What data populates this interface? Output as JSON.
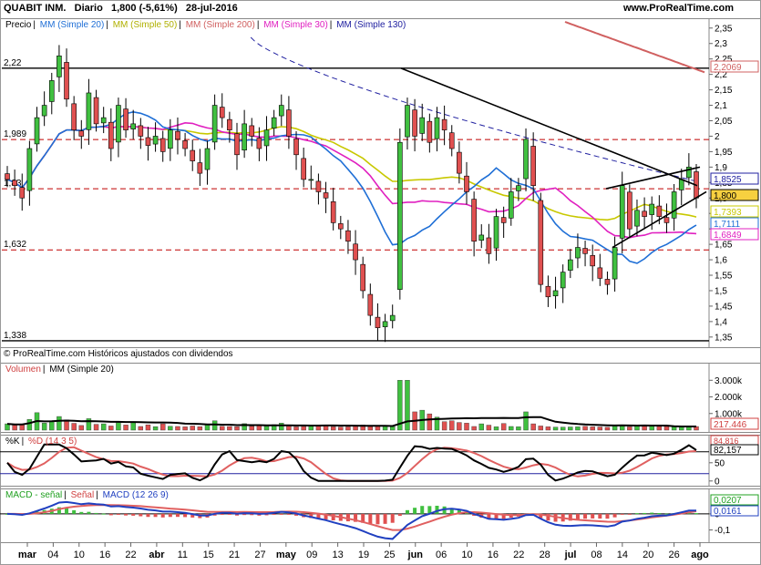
{
  "header": {
    "instrument": "QUABIT INM.",
    "period": "Diario",
    "quote": "1,800 (-5,61%)",
    "date": "28-jul-2016",
    "site": "www.ProRealTime.com"
  },
  "price_panel": {
    "legend": [
      {
        "text": "Precio",
        "color": "#000000"
      },
      {
        "text": "MM (Simple 20)",
        "color": "#1f6fd6"
      },
      {
        "text": "MM (Simple 50)",
        "color": "#c8c800"
      },
      {
        "text": "MM (Simple 200)",
        "color": "#d06060"
      },
      {
        "text": "MM (Simple 30)",
        "color": "#e020c0"
      },
      {
        "text": "MM (Simple 130)",
        "color": "#2020a0"
      }
    ],
    "footer": "© ProRealTime.com Históricos ajustados con dividendos",
    "left_levels": [
      "2,22",
      "1,989",
      "1,83",
      "1,632",
      "1,338"
    ],
    "right_badges": [
      {
        "text": "2,2069",
        "color": "#d06060"
      },
      {
        "text": "1,8525",
        "color": "#2020a0"
      },
      {
        "text": "1,800",
        "color": "#000000"
      },
      {
        "text": "1,7393",
        "color": "#c8c800"
      },
      {
        "text": "1,7111",
        "color": "#1f6fd6"
      },
      {
        "text": "1,6849",
        "color": "#e020c0"
      }
    ]
  },
  "volume_panel": {
    "legend": [
      {
        "text": "Volumen",
        "color": "#d04040"
      },
      {
        "text": "MM (Simple 20)",
        "color": "#000000"
      }
    ],
    "badge": "217.446"
  },
  "stoch_panel": {
    "legend": [
      {
        "text": "%K",
        "color": "#000000"
      },
      {
        "text": "%D (14 3 5)",
        "color": "#d04040"
      }
    ],
    "badges": [
      "84,816",
      "82,157"
    ]
  },
  "macd_panel": {
    "legend": [
      {
        "text": "MACD - señal",
        "color": "#20a020"
      },
      {
        "text": "Señal",
        "color": "#d04040"
      },
      {
        "text": "MACD (12 26 9)",
        "color": "#2040c0"
      }
    ],
    "badges": [
      "0,0207",
      "0,0161"
    ]
  },
  "chart_data": [
    {
      "type": "candlestick",
      "name": "Precio",
      "ylim": [
        1.32,
        2.37
      ],
      "yticks": [
        "2,35",
        "2,3",
        "2,25",
        "2,2",
        "2,15",
        "2,1",
        "2,05",
        "2",
        "1,95",
        "1,9",
        "1,85",
        "1,8",
        "1,75",
        "1,7",
        "1,65",
        "1,6",
        "1,55",
        "1,5",
        "1,45",
        "1,4",
        "1,35"
      ],
      "x_labels": [
        "mar",
        "04",
        "10",
        "16",
        "22",
        "abr",
        "11",
        "15",
        "21",
        "27",
        "may",
        "09",
        "13",
        "19",
        "25",
        "jun",
        "06",
        "10",
        "16",
        "22",
        "28",
        "jul",
        "08",
        "14",
        "20",
        "26",
        "ago"
      ],
      "close": [
        1.86,
        1.84,
        1.8,
        1.96,
        2.06,
        2.1,
        2.18,
        2.26,
        2.12,
        2.02,
        2.0,
        2.14,
        2.04,
        2.06,
        1.96,
        2.1,
        2.02,
        2.04,
        2.0,
        1.97,
        2.0,
        1.95,
        2.02,
        1.99,
        1.96,
        1.92,
        1.88,
        1.96,
        2.1,
        2.06,
        2.02,
        1.94,
        2.04,
        2.0,
        1.96,
        2.02,
        2.06,
        2.1,
        2.0,
        1.94,
        1.86,
        1.86,
        1.82,
        1.8,
        1.72,
        1.7,
        1.66,
        1.6,
        1.5,
        1.42,
        1.38,
        1.4,
        1.42,
        1.98,
        2.1,
        2.0,
        2.06,
        1.98,
        2.06,
        2.02,
        1.96,
        1.88,
        1.82,
        1.66,
        1.68,
        1.62,
        1.74,
        1.72,
        1.82,
        1.84,
        1.99,
        1.84,
        1.52,
        1.48,
        1.5,
        1.56,
        1.6,
        1.64,
        1.62,
        1.58,
        1.54,
        1.52,
        1.64,
        1.84,
        1.7,
        1.76,
        1.74,
        1.78,
        1.74,
        1.72,
        1.82,
        1.86,
        1.9,
        1.8
      ],
      "ma20_last": 1.7111,
      "ma30_last": 1.6849,
      "ma50_last": 1.7393,
      "ma130_last": 1.8525,
      "ma200_last": 2.2069,
      "levels": [
        2.22,
        1.989,
        1.83,
        1.632,
        1.338
      ]
    },
    {
      "type": "bar",
      "name": "Volumen",
      "ylim": [
        0,
        3400000
      ],
      "yticks": [
        "3.000k",
        "2.000k",
        "1.000k"
      ],
      "values": [
        380000,
        300000,
        360000,
        650000,
        1050000,
        420000,
        560000,
        820000,
        620000,
        410000,
        280000,
        690000,
        350000,
        380000,
        250000,
        460000,
        310000,
        510000,
        220000,
        320000,
        210000,
        380000,
        230000,
        220000,
        200000,
        250000,
        210000,
        360000,
        560000,
        230000,
        220000,
        210000,
        390000,
        240000,
        260000,
        230000,
        330000,
        420000,
        250000,
        200000,
        220000,
        230000,
        260000,
        280000,
        210000,
        190000,
        200000,
        240000,
        310000,
        220000,
        230000,
        250000,
        210000,
        3000000,
        3000000,
        1100000,
        1200000,
        980000,
        780000,
        510000,
        560000,
        460000,
        420000,
        220000,
        380000,
        300000,
        200000,
        400000,
        220000,
        200000,
        1100000,
        380000,
        250000,
        200000,
        180000,
        180000,
        190000,
        200000,
        230000,
        200000,
        190000,
        170000,
        250000,
        300000,
        200000,
        280000,
        260000,
        250000,
        220000,
        220000,
        240000,
        200000,
        260000,
        217446
      ],
      "ma20_last": 217446
    },
    {
      "type": "line",
      "name": "%K / %D (14 3 5)",
      "ylim": [
        -8,
        102
      ],
      "yticks": [
        "50",
        "0"
      ],
      "k_last": 84.816,
      "d_last": 82.157
    },
    {
      "type": "histogram",
      "name": "MACD (12 26 9)",
      "ylim": [
        -0.165,
        0.09
      ],
      "yticks": [
        "0",
        "-0,1"
      ],
      "macd_last": 0.0207,
      "signal_last": 0.0161
    }
  ]
}
